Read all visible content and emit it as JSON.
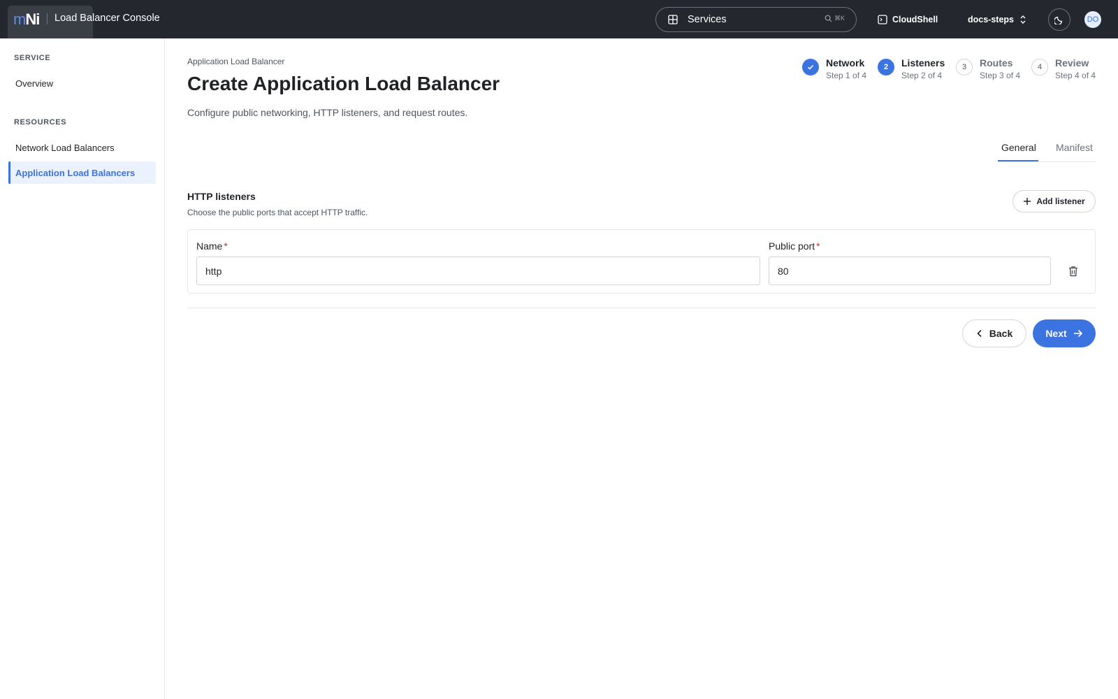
{
  "header": {
    "logo_m": "m",
    "logo_ni": "Ni",
    "app_title": "Load Balancer Console",
    "search_label": "Services",
    "search_shortcut": "⌘K",
    "cloudshell_label": "CloudShell",
    "project_label": "docs-steps",
    "avatar_initials": "DO"
  },
  "sidebar": {
    "sections": [
      {
        "title": "SERVICE",
        "items": [
          {
            "label": "Overview",
            "active": false
          }
        ]
      },
      {
        "title": "RESOURCES",
        "items": [
          {
            "label": "Network Load Balancers",
            "active": false
          },
          {
            "label": "Application Load Balancers",
            "active": true
          }
        ]
      }
    ]
  },
  "page": {
    "breadcrumb": "Application Load Balancer",
    "title": "Create Application Load Balancer",
    "description": "Configure public networking, HTTP listeners, and request routes."
  },
  "steps": [
    {
      "number": "1",
      "title": "Network",
      "subtitle": "Step 1 of 4",
      "state": "done"
    },
    {
      "number": "2",
      "title": "Listeners",
      "subtitle": "Step 2 of 4",
      "state": "current"
    },
    {
      "number": "3",
      "title": "Routes",
      "subtitle": "Step 3 of 4",
      "state": "todo"
    },
    {
      "number": "4",
      "title": "Review",
      "subtitle": "Step 4 of 4",
      "state": "todo"
    }
  ],
  "tabs": [
    {
      "label": "General",
      "active": true
    },
    {
      "label": "Manifest",
      "active": false
    }
  ],
  "listeners_section": {
    "title": "HTTP listeners",
    "subtitle": "Choose the public ports that accept HTTP traffic.",
    "add_button": "Add listener",
    "name_label": "Name",
    "port_label": "Public port",
    "required_marker": "*",
    "rows": [
      {
        "name": "http",
        "port": "80"
      }
    ]
  },
  "footer": {
    "back_label": "Back",
    "next_label": "Next"
  },
  "colors": {
    "accent": "#3b73e0",
    "topbar": "#24282e",
    "required": "#dc2626"
  }
}
